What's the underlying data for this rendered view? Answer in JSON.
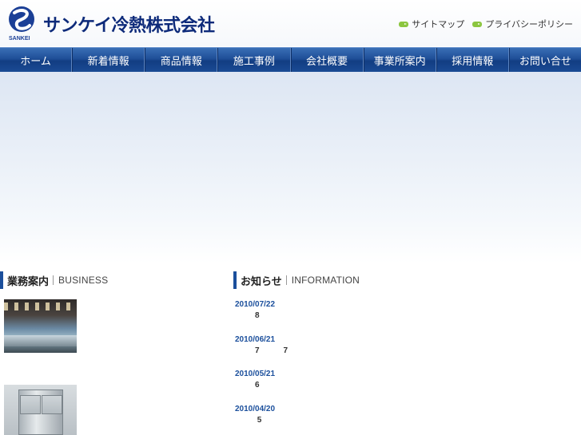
{
  "header": {
    "logo_subtext": "SANKEI",
    "company_name": "サンケイ冷熱株式会社",
    "util_links": [
      {
        "label": "サイトマップ",
        "icon": "arrow-badge-icon"
      },
      {
        "label": "プライバシーポリシー",
        "icon": "arrow-badge-icon"
      }
    ]
  },
  "nav": {
    "items": [
      {
        "label": "ホーム"
      },
      {
        "label": "新着情報"
      },
      {
        "label": "商品情報"
      },
      {
        "label": "施工事例"
      },
      {
        "label": "会社概要"
      },
      {
        "label": "事業所案内"
      },
      {
        "label": "採用情報"
      },
      {
        "label": "お問い合せ"
      }
    ]
  },
  "business": {
    "title_jp": "業務案内",
    "title_en": "BUSINESS"
  },
  "news": {
    "title_jp": "お知らせ",
    "title_en": "INFORMATION",
    "items": [
      {
        "date": "2010/07/22",
        "text": "8"
      },
      {
        "date": "2010/06/21",
        "text": "7　　　7"
      },
      {
        "date": "2010/05/21",
        "text": "6"
      },
      {
        "date": "2010/04/20",
        "text": " 5"
      }
    ]
  },
  "colors": {
    "brand_navy": "#0d2a7a",
    "nav_blue": "#1f4f98",
    "accent_green": "#8cc63f",
    "date_blue": "#1b4f9c"
  }
}
